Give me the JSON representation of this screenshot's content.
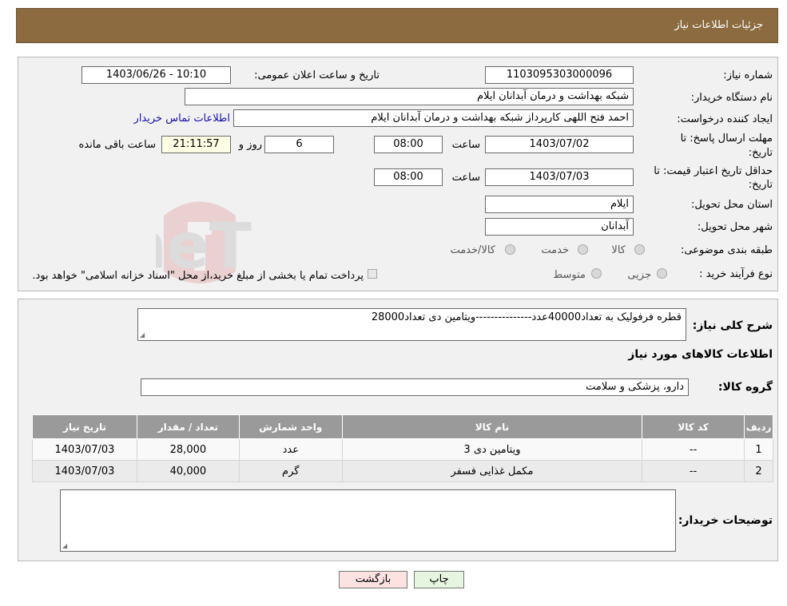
{
  "header": {
    "title": "جزئیات اطلاعات نیاز"
  },
  "form": {
    "need_number_label": "شماره نیاز:",
    "need_number": "1103095303000096",
    "announce_label": "تاریخ و ساعت اعلان عمومی:",
    "announce_value": "1403/06/26 - 10:10",
    "buyer_org_label": "نام دستگاه خریدار:",
    "buyer_org": "شبکه بهداشت و درمان آبدانان ایلام",
    "creator_label": "ایجاد کننده درخواست:",
    "creator": "احمد فتح اللهی کارپرداز شبکه بهداشت و درمان آبدانان ایلام",
    "contact_link": "اطلاعات تماس خریدار",
    "deadline_label_1": "مهلت ارسال پاسخ: تا",
    "deadline_label_2": "تاریخ:",
    "deadline_date": "1403/07/02",
    "time_label": "ساعت",
    "deadline_time": "08:00",
    "days_value": "6",
    "days_label": "روز و",
    "remaining_time": "21:11:57",
    "remaining_label": "ساعت باقی مانده",
    "validity_label_1": "حداقل تاریخ اعتبار قیمت: تا",
    "validity_label_2": "تاریخ:",
    "validity_date": "1403/07/03",
    "validity_time": "08:00",
    "province_label": "استان محل تحویل:",
    "province": "ایلام",
    "city_label": "شهر محل تحویل:",
    "city": "آبدانان",
    "category_label": "طبقه بندی موضوعی:",
    "category_options": [
      "کالا",
      "خدمت",
      "کالا/خدمت"
    ],
    "purchase_type_label": "نوع فرآیند خرید :",
    "purchase_options": [
      "جزیی",
      "متوسط"
    ],
    "purchase_note": "پرداخت تمام یا بخشی از مبلغ خرید،از محل \"اسناد خزانه اسلامی\" خواهد بود."
  },
  "summary": {
    "label": "شرح کلی نیاز:",
    "text": "قطره فرفولیک به تعداد40000عدد---------------ویتامین دی  تعداد28000"
  },
  "items_section": {
    "title": "اطلاعات کالاهای مورد نیاز",
    "group_label": "گروه کالا:",
    "group_value": "دارو، پزشکی و سلامت",
    "columns": [
      "ردیف",
      "کد کالا",
      "نام کالا",
      "واحد شمارش",
      "تعداد / مقدار",
      "تاریخ نیاز"
    ],
    "rows": [
      [
        "1",
        "--",
        "ویتامین دی 3",
        "عدد",
        "28,000",
        "1403/07/03"
      ],
      [
        "2",
        "--",
        "مکمل غذایی فسفر",
        "گرم",
        "40,000",
        "1403/07/03"
      ]
    ]
  },
  "notes": {
    "label": "توضیحات خریدار:",
    "value": ""
  },
  "buttons": {
    "print": "چاپ",
    "back": "بازگشت"
  },
  "watermark": {
    "text": "AriaTender.neT"
  },
  "colors": {
    "header": "#8b6b3f",
    "table_header": "#9a9a9a",
    "back_button": "#fde2e2",
    "print_button": "#e6f5e0"
  }
}
